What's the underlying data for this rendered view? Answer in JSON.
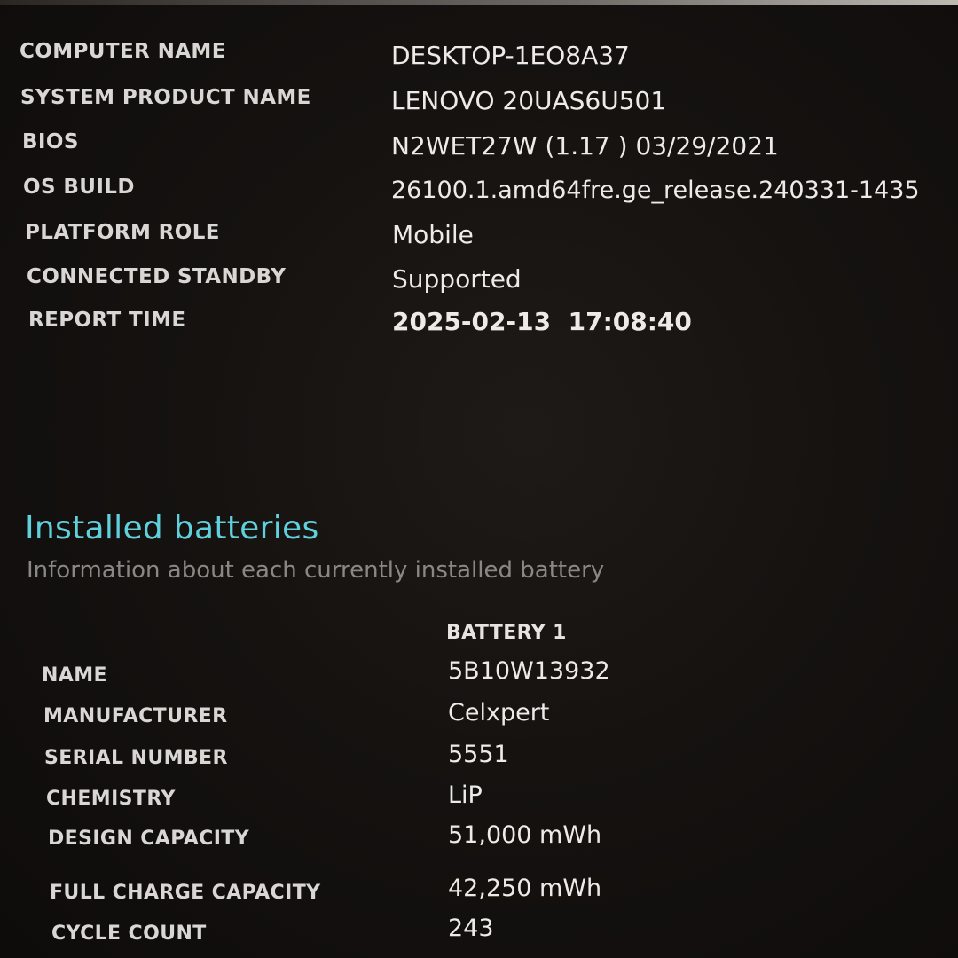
{
  "system_info": [
    {
      "label": "COMPUTER NAME",
      "value": "DESKTOP-1EO8A37"
    },
    {
      "label": "SYSTEM PRODUCT NAME",
      "value": "LENOVO 20UAS6U501"
    },
    {
      "label": "BIOS",
      "value": "N2WET27W (1.17 ) 03/29/2021"
    },
    {
      "label": "OS BUILD",
      "value": "26100.1.amd64fre.ge_release.240331-1435"
    },
    {
      "label": "PLATFORM ROLE",
      "value": "Mobile"
    },
    {
      "label": "CONNECTED STANDBY",
      "value": "Supported"
    },
    {
      "label": "REPORT TIME",
      "value": "2025-02-13  17:08:40"
    }
  ],
  "installed_batteries": {
    "title": "Installed batteries",
    "subtitle": "Information about each currently installed battery",
    "column_header": "BATTERY 1",
    "rows": [
      {
        "label": "NAME",
        "value": "5B10W13932"
      },
      {
        "label": "MANUFACTURER",
        "value": "Celxpert"
      },
      {
        "label": "SERIAL NUMBER",
        "value": "5551"
      },
      {
        "label": "CHEMISTRY",
        "value": "LiP"
      },
      {
        "label": "DESIGN CAPACITY",
        "value": "51,000 mWh"
      },
      {
        "label": "FULL CHARGE CAPACITY",
        "value": "42,250 mWh"
      },
      {
        "label": "CYCLE COUNT",
        "value": "243"
      }
    ]
  },
  "colors": {
    "background": "#151210",
    "section_title": "#5fd0dc",
    "subtitle": "#8a8885",
    "text": "#ecebe8"
  }
}
